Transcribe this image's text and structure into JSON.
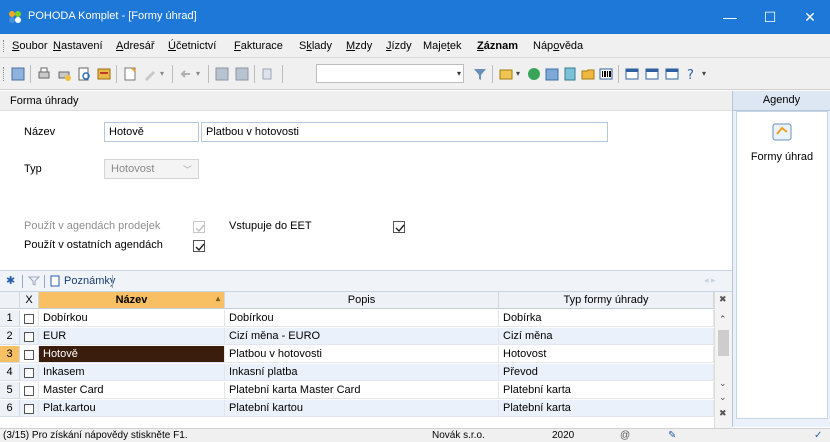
{
  "window": {
    "title": "POHODA Komplet - [Formy úhrad]",
    "minimize": "—",
    "maximize": "☐",
    "close": "✕"
  },
  "menu": [
    {
      "pre": "",
      "u": "S",
      "post": "oubor"
    },
    {
      "pre": "",
      "u": "N",
      "post": "astavení"
    },
    {
      "pre": "",
      "u": "A",
      "post": "dresář"
    },
    {
      "pre": "",
      "u": "Ú",
      "post": "četnictví"
    },
    {
      "pre": "",
      "u": "F",
      "post": "akturace"
    },
    {
      "pre": "S",
      "u": "k",
      "post": "lady"
    },
    {
      "pre": "",
      "u": "M",
      "post": "zdy"
    },
    {
      "pre": "",
      "u": "J",
      "post": "ízdy"
    },
    {
      "pre": "Maje",
      "u": "t",
      "post": "ek"
    },
    {
      "pre": "",
      "u": "Z",
      "post": "áznam"
    },
    {
      "pre": "Náp",
      "u": "o",
      "post": "věda"
    }
  ],
  "form": {
    "section_title": "Forma úhrady",
    "nazev_label": "Název",
    "nazev_value": "Hotově",
    "popis_value": "Platbou v hotovosti",
    "typ_label": "Typ",
    "typ_value": "Hotovost",
    "prodejky_label": "Použít v agendách prodejek",
    "eet_label": "Vstupuje do EET",
    "ostatni_label": "Použít v ostatních agendách"
  },
  "agendy": {
    "header": "Agendy",
    "item_label": "Formy úhrad"
  },
  "grid": {
    "tab_label": "Poznámky",
    "columns": {
      "x": "X",
      "nazev": "Název",
      "popis": "Popis",
      "typ": "Typ formy úhrady"
    },
    "rows": [
      {
        "num": "1",
        "nazev": "Dobírkou",
        "popis": "Dobírkou",
        "typ": "Dobírka"
      },
      {
        "num": "2",
        "nazev": "EUR",
        "popis": "Cizí měna - EURO",
        "typ": "Cizí měna"
      },
      {
        "num": "3",
        "nazev": "Hotově",
        "popis": "Platbou v hotovosti",
        "typ": "Hotovost"
      },
      {
        "num": "4",
        "nazev": "Inkasem",
        "popis": "Inkasní platba",
        "typ": "Převod"
      },
      {
        "num": "5",
        "nazev": "Master Card",
        "popis": "Platební karta Master Card",
        "typ": "Platební karta"
      },
      {
        "num": "6",
        "nazev": "Plat.kartou",
        "popis": "Platební kartou",
        "typ": "Platební karta"
      }
    ]
  },
  "status": {
    "help": "(3/15) Pro získání nápovědy stiskněte F1.",
    "company": "Novák s.r.o.",
    "year": "2020"
  },
  "colors": {
    "titlebar": "#1e78d7",
    "selected_row": "#3b1d0e",
    "sort_header": "#f8bf63"
  }
}
